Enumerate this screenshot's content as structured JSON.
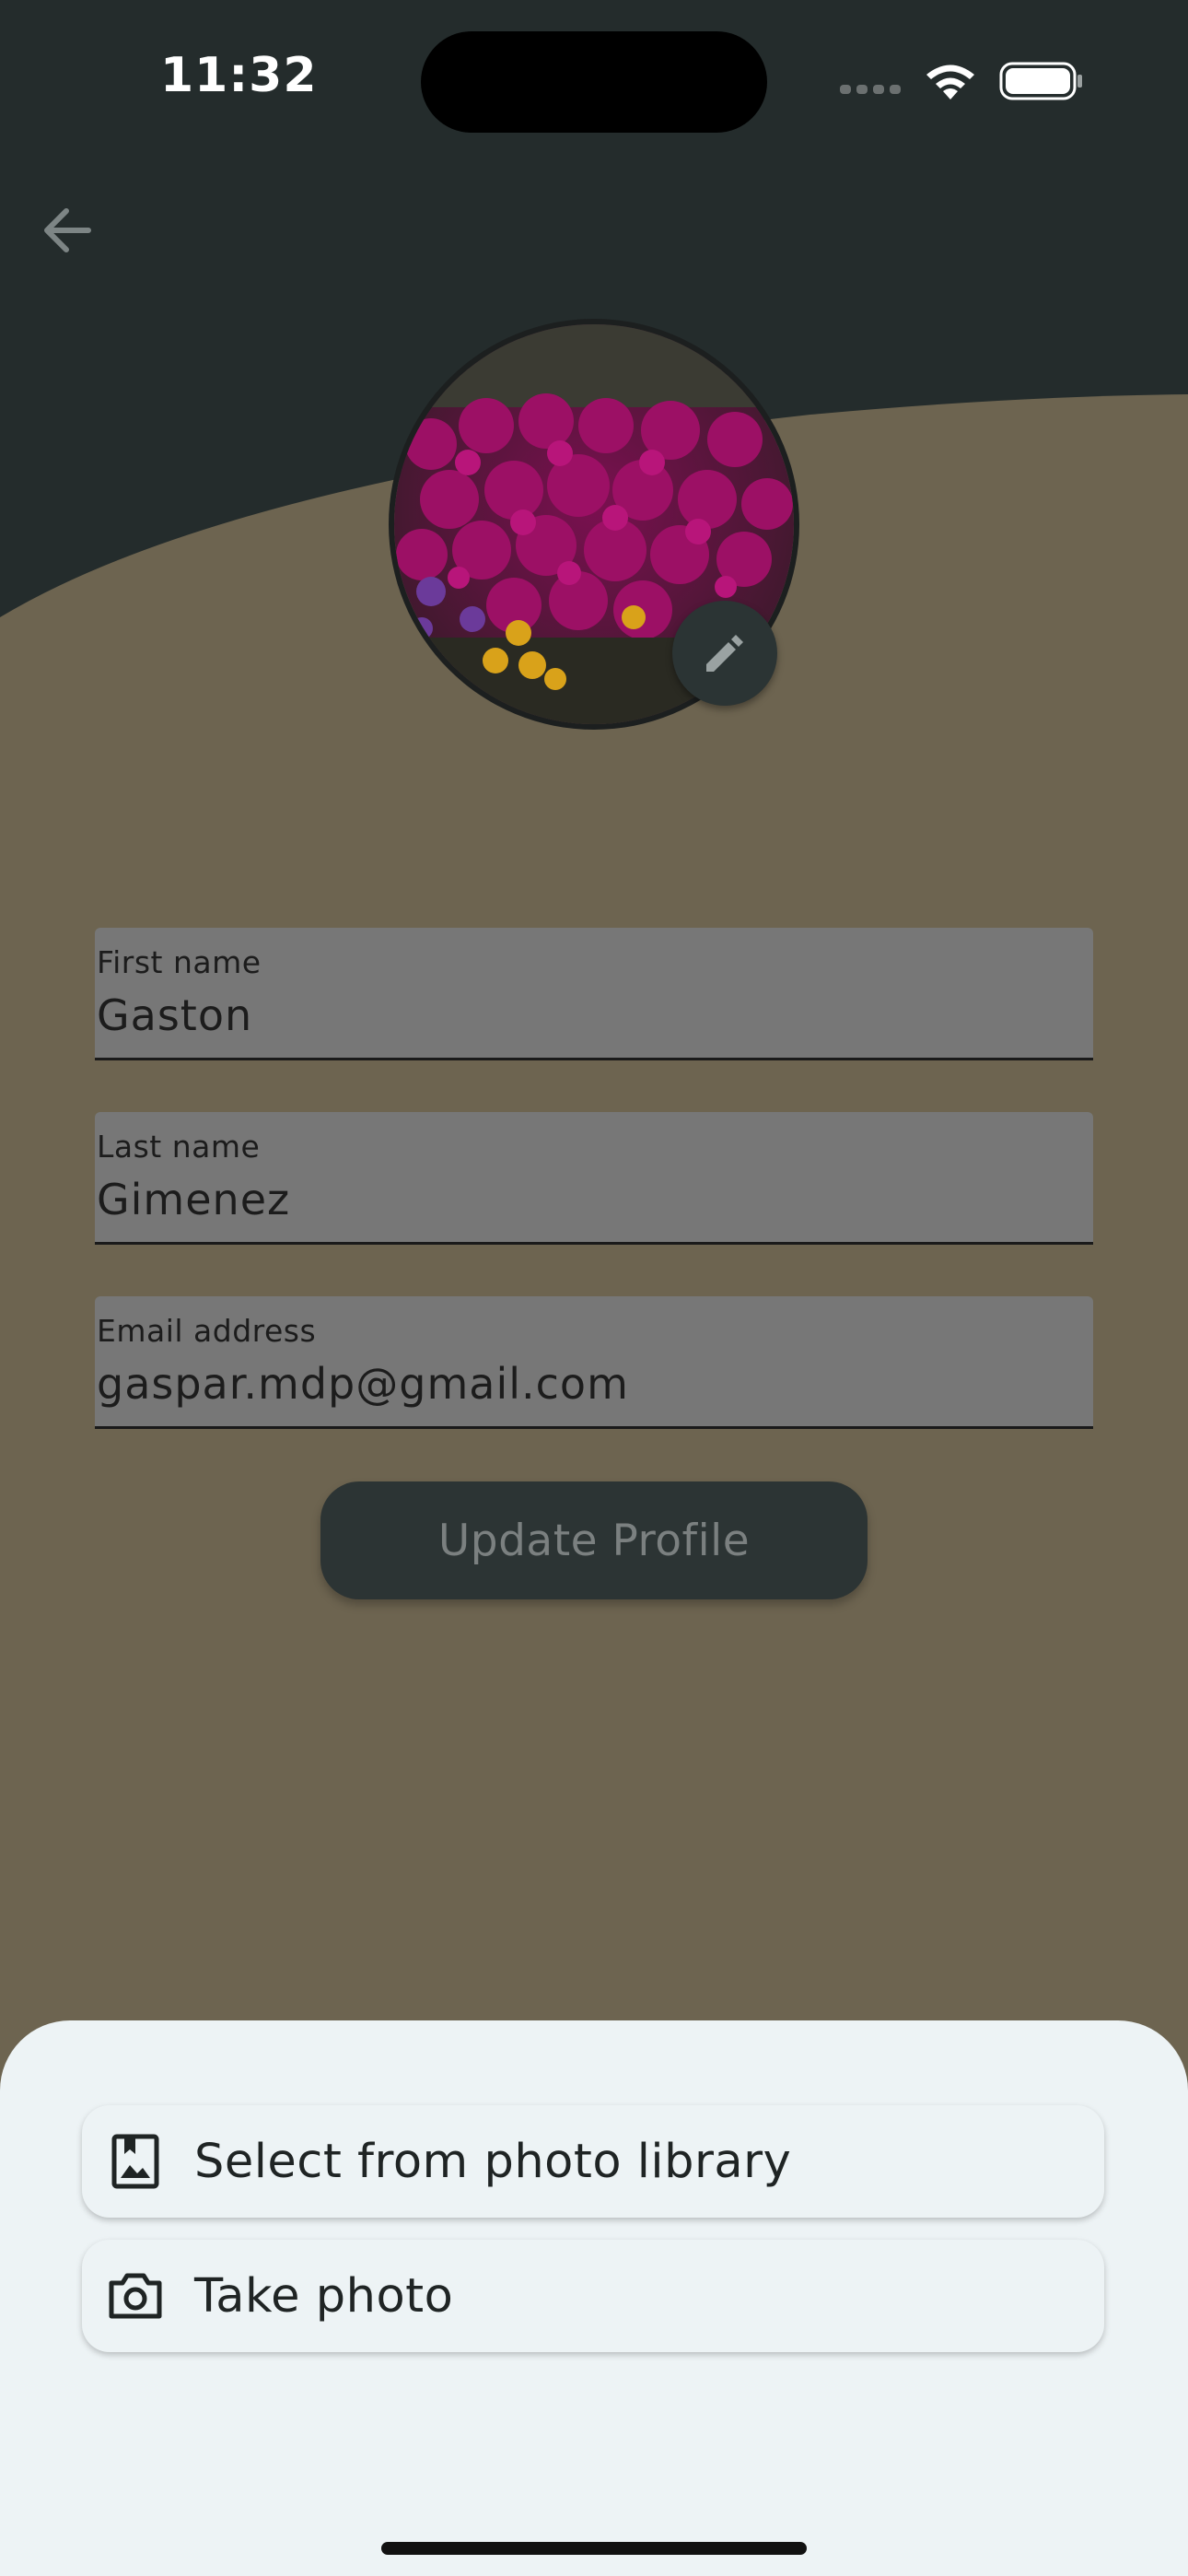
{
  "status_bar": {
    "time": "11:32"
  },
  "nav": {
    "back_icon": "arrow-left-icon"
  },
  "profile": {
    "avatar_image": "purple flower field photo",
    "edit_icon": "pencil-icon"
  },
  "form": {
    "first_name": {
      "label": "First name",
      "value": "Gaston"
    },
    "last_name": {
      "label": "Last name",
      "value": "Gimenez"
    },
    "email": {
      "label": "Email address",
      "value": "gaspar.mdp@gmail.com"
    },
    "update_label": "Update Profile"
  },
  "sheet": {
    "items": [
      {
        "label": "Select from photo library",
        "icon": "photo-library-icon"
      },
      {
        "label": "Take photo",
        "icon": "camera-icon"
      }
    ]
  },
  "colors": {
    "header_dark": "#242c2c",
    "background": "#6d6450",
    "field_fill": "#777777",
    "button": "#2c3434",
    "sheet": "#edf3f5"
  }
}
